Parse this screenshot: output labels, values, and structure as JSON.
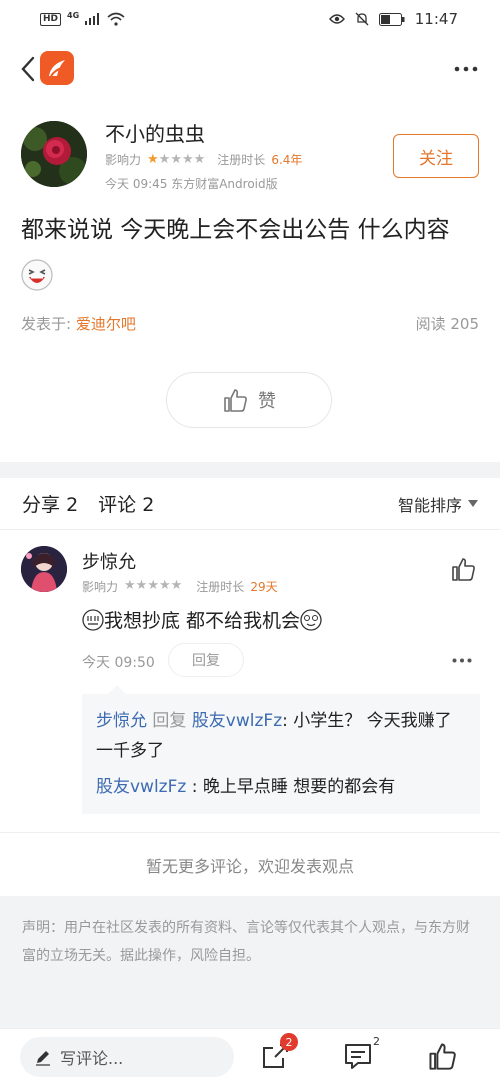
{
  "status_bar": {
    "hd": "HD",
    "network": "4G",
    "time": "11:47"
  },
  "post": {
    "author": "不小的虫虫",
    "influence_label": "影响力",
    "influence_stars_filled": 1,
    "influence_stars_total": 5,
    "reg_label": "注册时长",
    "reg_value": "6.4年",
    "time_line": "今天 09:45 东方财富Android版",
    "follow_label": "关注",
    "content": "都来说说 今天晚上会不会出公告 什么内容",
    "posted_in_label": "发表于:",
    "forum": "爱迪尔吧",
    "read_label": "阅读",
    "read_count": "205",
    "like_label": "赞"
  },
  "comments_header": {
    "share_label": "分享",
    "share_count": "2",
    "comment_label": "评论",
    "comment_count": "2",
    "sort_label": "智能排序"
  },
  "comment": {
    "author": "步惊允",
    "influence_label": "影响力",
    "reg_label": "注册时长",
    "reg_value": "29天",
    "text": "我想抄底  都不给我机会",
    "time": "今天 09:50",
    "reply_label": "回复",
    "replies": [
      {
        "from": "步惊允",
        "verb": "回复",
        "to": "股友vwlzFz",
        "text": "小学生？  今天我赚了一千多了"
      },
      {
        "from": "股友vwlzFz",
        "text": "晚上早点睡 想要的都会有"
      }
    ]
  },
  "no_more": "暂无更多评论，欢迎发表观点",
  "disclaimer": "声明：用户在社区发表的所有资料、言论等仅代表其个人观点，与东方财富的立场无关。据此操作，风险自担。",
  "bottom_bar": {
    "input_placeholder": "写评论...",
    "share_badge": "2",
    "comment_badge": "2"
  },
  "colors": {
    "accent": "#e5772b",
    "link": "#3c6bb1",
    "badge": "#e03b2e"
  }
}
